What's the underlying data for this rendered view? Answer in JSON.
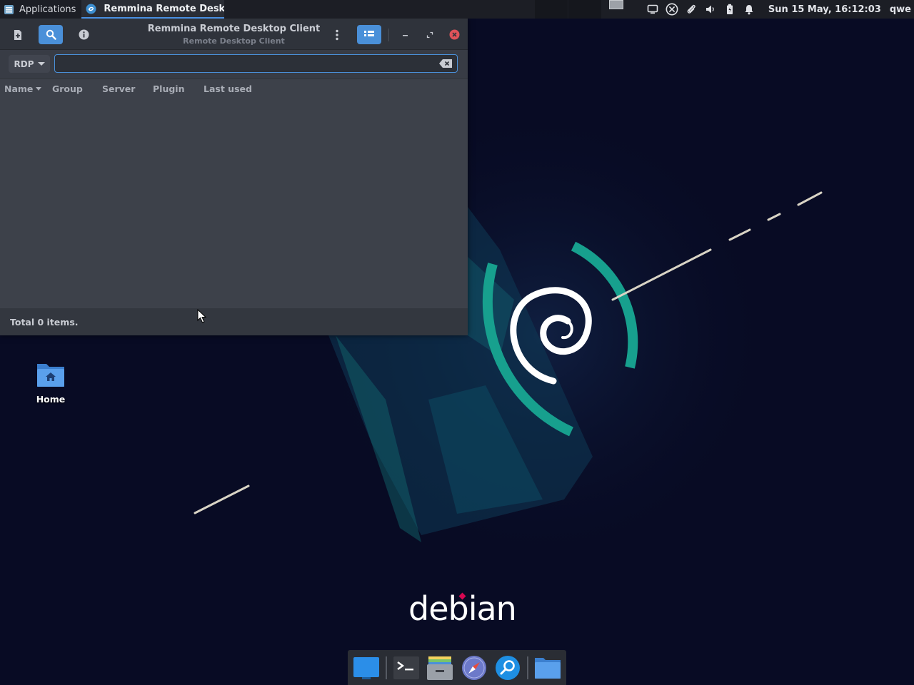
{
  "top_panel": {
    "applications_label": "Applications",
    "active_task_label": "Remmina Remote Deskto...",
    "clock": "Sun 15 May, 16:12:03",
    "user": "qwe"
  },
  "window": {
    "title": "Remmina Remote Desktop Client",
    "subtitle": "Remote Desktop Client",
    "protocol": "RDP",
    "search_value": "",
    "columns": [
      "Name",
      "Group",
      "Server",
      "Plugin",
      "Last used"
    ],
    "status": "Total 0 items."
  },
  "desktop": {
    "home_label": "Home",
    "brand": "debian"
  },
  "colors": {
    "accent": "#4a90d9",
    "close": "#e0535a",
    "debian_teal": "#17a08e",
    "desktop_bg": "#080b24"
  }
}
